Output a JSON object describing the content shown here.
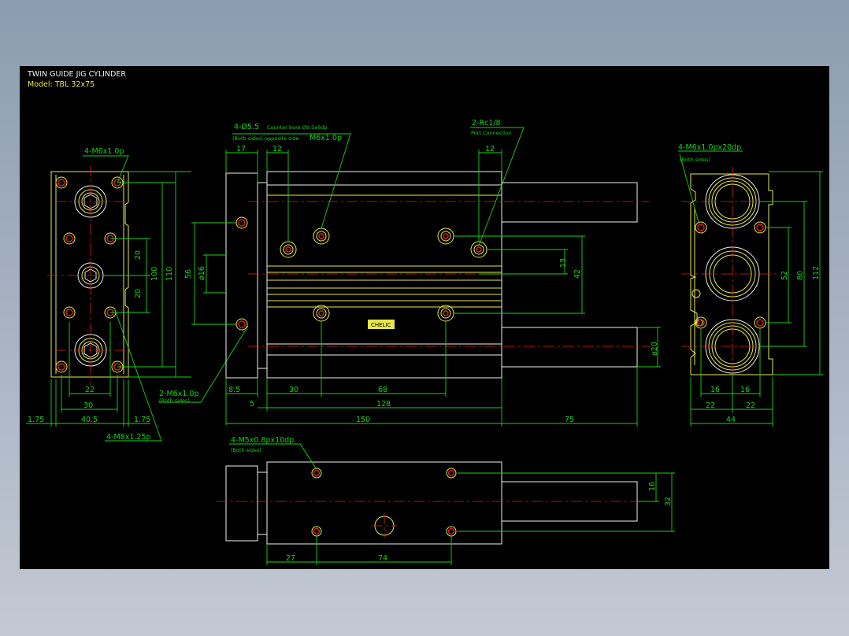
{
  "title": "TWIN GUIDE JIG CYLINDER",
  "model": "Model: TBL 32x75",
  "nameplate": "CHELIC",
  "colors": {
    "background": "#000000",
    "dimension": "#19d219",
    "outline": "#e8e84a",
    "edge": "#f0f0f0",
    "centerline": "#e01e1e"
  },
  "left_view": {
    "callout_top": "4-M6x1.0p",
    "callout_left": "2-M6x1.0p",
    "callout_left_sub": "(Both sides)",
    "callout_bottom": "4-M8x1.25p",
    "dims": {
      "d20a": "20",
      "d20b": "20",
      "d100": "100",
      "d110": "110",
      "d22": "22",
      "d30": "30",
      "d40_5": "40.5",
      "d1_75a": "1.75",
      "d1_75b": "1.75"
    }
  },
  "front_view": {
    "callout_mount": "4-Ø5.5",
    "callout_mount_cb": "Counter bore Ø9.5x6dp",
    "callout_mount_sub": "(Both sides),opposite side",
    "callout_mount_thread": "M6x1.0p",
    "callout_port": "2-Rc1/8",
    "callout_port_sub": "Port Connection",
    "dims": {
      "d17": "17",
      "d12a": "12",
      "d12b": "12",
      "d56": "56",
      "d16": "ø16",
      "d13": "13",
      "d42": "42",
      "d20": "ø20",
      "d8_5": "8.5",
      "d30": "30",
      "d68": "68",
      "d5": "5",
      "d128": "128",
      "d150": "150",
      "d75": "75"
    }
  },
  "right_view": {
    "callout": "4-M6x1.0px20dp",
    "callout_sub": "(Both sides)",
    "dims": {
      "d52": "52",
      "d80": "80",
      "d112": "112",
      "d16a": "16",
      "d16b": "16",
      "d22a": "22",
      "d22b": "22",
      "d44": "44"
    }
  },
  "bottom_view": {
    "callout": "4-M5x0.8px10dp.",
    "callout_sub": "(Both sides)",
    "dims": {
      "d16": "16",
      "d32": "32",
      "d27": "27",
      "d74": "74"
    }
  }
}
